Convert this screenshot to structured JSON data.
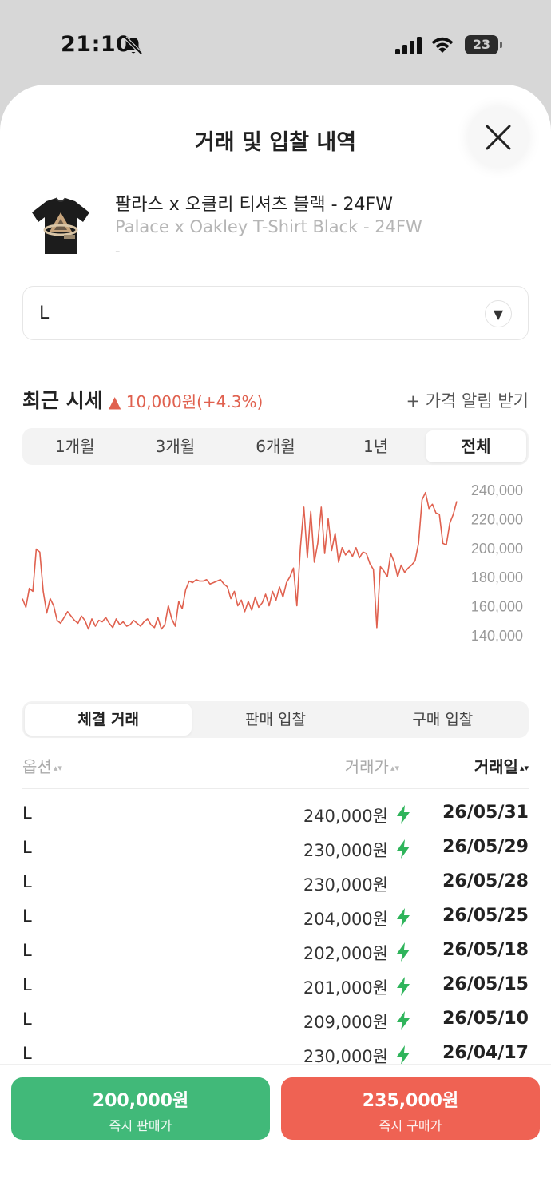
{
  "status": {
    "time": "21:10",
    "battery": "23"
  },
  "sheet": {
    "title": "거래 및 입찰 내역"
  },
  "product": {
    "name_ko": "팔라스 x 오클리 티셔츠 블랙 - 24FW",
    "name_en": "Palace x Oakley T-Shirt Black - 24FW",
    "sub": "-"
  },
  "size_select": {
    "value": "L"
  },
  "recent": {
    "title": "최근 시세",
    "change": "▲ 10,000원(+4.3%)",
    "alert": "+ 가격 알림 받기"
  },
  "period_tabs": [
    {
      "label": "1개월"
    },
    {
      "label": "3개월"
    },
    {
      "label": "6개월"
    },
    {
      "label": "1년"
    },
    {
      "label": "전체",
      "active": true
    }
  ],
  "chart_data": {
    "type": "line",
    "xlabel": "",
    "ylabel": "",
    "ylim": [
      135000,
      245000
    ],
    "yticks": [
      "240,000",
      "220,000",
      "200,000",
      "180,000",
      "160,000",
      "140,000"
    ],
    "ytick_values": [
      240000,
      220000,
      200000,
      180000,
      160000,
      140000
    ],
    "series": [
      {
        "color": "#e0614f",
        "values": [
          165000,
          159000,
          172000,
          170000,
          199000,
          197000,
          170000,
          155000,
          165000,
          160000,
          150000,
          148000,
          152000,
          156000,
          153000,
          150000,
          148000,
          153000,
          150000,
          144000,
          151000,
          146000,
          150000,
          149000,
          152000,
          148000,
          145000,
          151000,
          147000,
          149000,
          146000,
          147000,
          150000,
          148000,
          146000,
          149000,
          151000,
          147000,
          145000,
          152000,
          144000,
          147000,
          160000,
          151000,
          146000,
          163000,
          158000,
          171000,
          177000,
          176000,
          178000,
          177000,
          177000,
          178000,
          175000,
          176000,
          177000,
          178000,
          175000,
          173000,
          165000,
          170000,
          160000,
          164000,
          156000,
          163000,
          157000,
          166000,
          159000,
          162000,
          168000,
          160000,
          170000,
          164000,
          173000,
          166000,
          176000,
          180000,
          186000,
          160000,
          200000,
          228000,
          193000,
          225000,
          190000,
          203000,
          228000,
          196000,
          220000,
          198000,
          210000,
          190000,
          200000,
          195000,
          198000,
          194000,
          200000,
          193000,
          197000,
          196000,
          189000,
          185000,
          145000,
          187000,
          184000,
          180000,
          196000,
          190000,
          180000,
          188000,
          183000,
          186000,
          188000,
          191000,
          203000,
          233000,
          238000,
          227000,
          230000,
          224000,
          223000,
          203000,
          202000,
          217000,
          223000,
          232000
        ]
      }
    ]
  },
  "trade_tabs": [
    {
      "label": "체결 거래",
      "active": true
    },
    {
      "label": "판매 입찰"
    },
    {
      "label": "구매 입찰"
    }
  ],
  "table": {
    "headers": {
      "option": "옵션",
      "price": "거래가",
      "date": "거래일"
    },
    "rows": [
      {
        "option": "L",
        "price": "240,000원",
        "fast": true,
        "date": "26/05/31"
      },
      {
        "option": "L",
        "price": "230,000원",
        "fast": true,
        "date": "26/05/29"
      },
      {
        "option": "L",
        "price": "230,000원",
        "fast": false,
        "date": "26/05/28"
      },
      {
        "option": "L",
        "price": "204,000원",
        "fast": true,
        "date": "26/05/25"
      },
      {
        "option": "L",
        "price": "202,000원",
        "fast": true,
        "date": "26/05/18"
      },
      {
        "option": "L",
        "price": "201,000원",
        "fast": true,
        "date": "26/05/15"
      },
      {
        "option": "L",
        "price": "209,000원",
        "fast": true,
        "date": "26/05/10"
      },
      {
        "option": "L",
        "price": "230,000원",
        "fast": true,
        "date": "26/04/17"
      }
    ]
  },
  "actions": {
    "sell": {
      "price": "200,000원",
      "label": "즉시 판매가",
      "color": "#41b979"
    },
    "buy": {
      "price": "235,000원",
      "label": "즉시 구매가",
      "color": "#ef6253"
    }
  }
}
